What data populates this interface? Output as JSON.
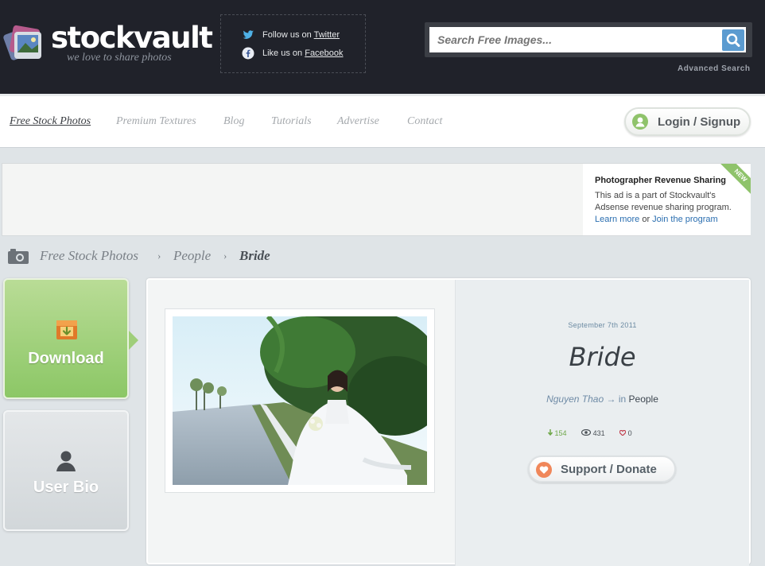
{
  "brand": {
    "name": "stockvault",
    "tagline": "we love to share photos"
  },
  "social": {
    "twitter_prefix": "Follow us on",
    "twitter_link": "Twitter",
    "facebook_prefix": "Like us on",
    "facebook_link": "Facebook"
  },
  "search": {
    "placeholder": "Search Free Images...",
    "advanced": "Advanced Search"
  },
  "nav": {
    "items": [
      "Free Stock Photos",
      "Premium Textures",
      "Blog",
      "Tutorials",
      "Advertise",
      "Contact"
    ],
    "login": "Login / Signup"
  },
  "ad": {
    "badge": "NEW",
    "title": "Photographer Revenue Sharing",
    "text": "This ad is a part of Stockvault's Adsense revenue sharing program.",
    "learn_more": "Learn more",
    "or": "or",
    "join": "Join the program"
  },
  "breadcrumb": {
    "items": [
      "Free Stock Photos",
      "People",
      "Bride"
    ],
    "separator": "›"
  },
  "sidebar": {
    "download": "Download",
    "user_bio": "User Bio"
  },
  "photo": {
    "date": "September 7th 2011",
    "title": "Bride",
    "author": "Nguyen Thao",
    "arrow": "→ in",
    "category": "People",
    "downloads": "154",
    "views": "431",
    "likes": "0",
    "support": "Support / Donate"
  },
  "colors": {
    "accent_green": "#8fc36b",
    "header_bg": "#20222a",
    "link_blue": "#2a6eb0",
    "donate_orange": "#f0875a"
  }
}
